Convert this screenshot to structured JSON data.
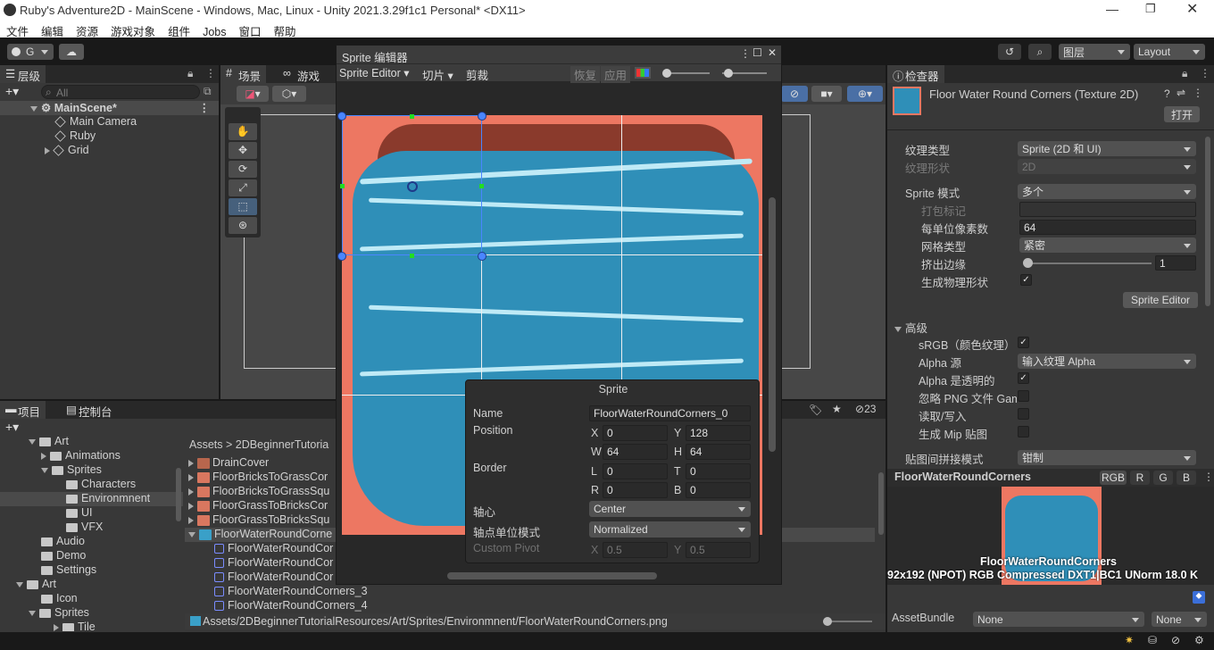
{
  "window": {
    "title": "Ruby's Adventure2D - MainScene - Windows, Mac, Linux - Unity 2021.3.29f1c1 Personal* <DX11>"
  },
  "menu": [
    "文件",
    "编辑",
    "资源",
    "游戏对象",
    "组件",
    "Jobs",
    "窗口",
    "帮助"
  ],
  "toolbar": {
    "account": "G",
    "layers": "图层",
    "layout": "Layout"
  },
  "hierarchy": {
    "tab": "层级",
    "search_placeholder": "All",
    "scene": "MainScene*",
    "items": [
      "Main Camera",
      "Ruby",
      "Grid"
    ]
  },
  "scene_view": {
    "tab_scene": "场景",
    "tab_game": "游戏"
  },
  "sprite_editor": {
    "title": "Sprite 编辑器",
    "mode": "Sprite Editor",
    "slice": "切片",
    "trim": "剪裁",
    "revert": "恢复",
    "apply": "应用",
    "popup": {
      "header": "Sprite",
      "name_label": "Name",
      "name_value": "FloorWaterRoundCorners_0",
      "position_label": "Position",
      "x": "0",
      "y": "128",
      "w": "64",
      "h": "64",
      "border_label": "Border",
      "l": "0",
      "t": "0",
      "r": "0",
      "b": "0",
      "pivot_label": "轴心",
      "pivot_value": "Center",
      "pivot_unit_label": "轴点单位模式",
      "pivot_unit_value": "Normalized",
      "custom_pivot_label": "Custom Pivot",
      "cpx": "0.5",
      "cpy": "0.5",
      "lx": "X",
      "ly": "Y",
      "lw": "W",
      "lh": "H",
      "ll": "L",
      "lt": "T",
      "lr": "R",
      "lb": "B"
    }
  },
  "project": {
    "tab_project": "项目",
    "tab_console": "控制台",
    "tree": [
      "Art",
      "Animations",
      "Sprites",
      "Characters",
      "Environmnent",
      "UI",
      "VFX",
      "Audio",
      "Demo",
      "Settings",
      "Art",
      "Icon",
      "Sprites",
      "Tile"
    ],
    "breadcrumb_root": "Assets",
    "breadcrumb_2": "2DBeginnerTutoria",
    "files": [
      "DrainCover",
      "FloorBricksToGrassCor",
      "FloorBricksToGrassSqu",
      "FloorGrassToBricksCor",
      "FloorGrassToBricksSqu",
      "FloorWaterRoundCorne",
      "FloorWaterRoundCor",
      "FloorWaterRoundCor",
      "FloorWaterRoundCor",
      "FloorWaterRoundCorners_3",
      "FloorWaterRoundCorners_4"
    ],
    "path": "Assets/2DBeginnerTutorialResources/Art/Sprites/Environmnent/FloorWaterRoundCorners.png",
    "hidden_count": "23"
  },
  "inspector": {
    "tab": "检查器",
    "asset_title": "Floor Water Round Corners (Texture 2D)",
    "open": "打开",
    "texture_type_label": "纹理类型",
    "texture_type": "Sprite (2D 和 UI)",
    "texture_shape_label": "纹理形状",
    "texture_shape": "2D",
    "sprite_mode_label": "Sprite 模式",
    "sprite_mode": "多个",
    "packing_tag_label": "打包标记",
    "ppu_label": "每单位像素数",
    "ppu": "64",
    "mesh_type_label": "网格类型",
    "mesh_type": "紧密",
    "extrude_label": "挤出边缘",
    "extrude": "1",
    "gen_physics_label": "生成物理形状",
    "sprite_editor_btn": "Sprite Editor",
    "advanced": "高级",
    "srgb_label": "sRGB（颜色纹理）",
    "alpha_source_label": "Alpha 源",
    "alpha_source": "输入纹理 Alpha",
    "alpha_transparent_label": "Alpha 是透明的",
    "ignore_png_label": "忽略 PNG 文件 Gam",
    "read_write_label": "读取/写入",
    "mip_label": "生成 Mip 贴图",
    "wrap_label": "贴图间拼接模式",
    "wrap": "钳制",
    "preview_title": "FloorWaterRoundCorners",
    "ch_rgb": "RGB",
    "ch_r": "R",
    "ch_g": "G",
    "ch_b": "B",
    "preview_name": "FloorWaterRoundCorners",
    "preview_info": "92x192 (NPOT)  RGB Compressed DXT1|BC1 UNorm   18.0 K",
    "assetbundle_label": "AssetBundle",
    "assetbundle": "None",
    "assetbundle_variant": "None"
  }
}
